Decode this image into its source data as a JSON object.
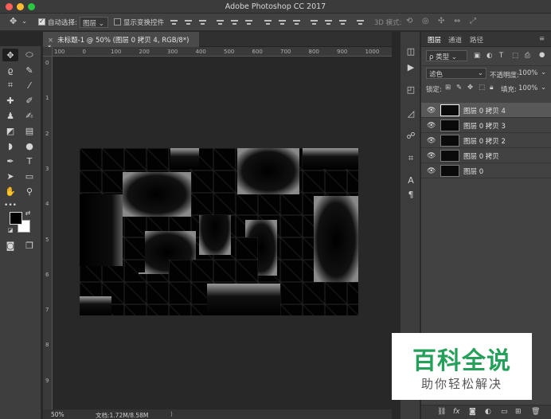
{
  "window": {
    "title": "Adobe Photoshop CC 2017"
  },
  "options_bar": {
    "auto_select_label": "自动选择:",
    "auto_select_value": "图层",
    "show_transform_label": "显示变换控件",
    "mode_3d_label": "3D 模式:"
  },
  "document": {
    "tab_title": "未标题-1 @ 50% (图层 0 拷贝 4, RGB/8*) *",
    "ruler_h_labels": [
      "100",
      "0",
      "100",
      "200",
      "300",
      "400",
      "500",
      "600",
      "700",
      "800",
      "900",
      "1000"
    ],
    "ruler_v_labels": [
      "0",
      "1",
      "2",
      "3",
      "4",
      "5",
      "6",
      "7",
      "8",
      "9"
    ]
  },
  "status": {
    "zoom": "50%",
    "doc_info": "文档:1.72M/8.58M"
  },
  "panel": {
    "tabs": [
      "图层",
      "通道",
      "路径"
    ],
    "filter_label": "ρ 类型",
    "blend_mode": "滤色",
    "opacity_label": "不透明度:",
    "opacity_value": "100%",
    "lock_label": "锁定:",
    "fill_label": "填充:",
    "fill_value": "100%",
    "layers": [
      {
        "name": "图层 0 拷贝 4",
        "selected": true
      },
      {
        "name": "图层 0 拷贝 3",
        "selected": false
      },
      {
        "name": "图层 0 拷贝 2",
        "selected": false
      },
      {
        "name": "图层 0 拷贝",
        "selected": false
      },
      {
        "name": "图层 0",
        "selected": false
      }
    ],
    "bottom_icons": [
      "link-icon",
      "fx-icon",
      "mask-icon",
      "adjustment-icon",
      "folder-icon",
      "new-layer-icon",
      "trash-icon"
    ]
  },
  "watermark": {
    "title": "百科全说",
    "subtitle": "助你轻松解决"
  },
  "colors": {
    "accent_watermark": "#24a05a",
    "selected_layer": "#585858"
  }
}
